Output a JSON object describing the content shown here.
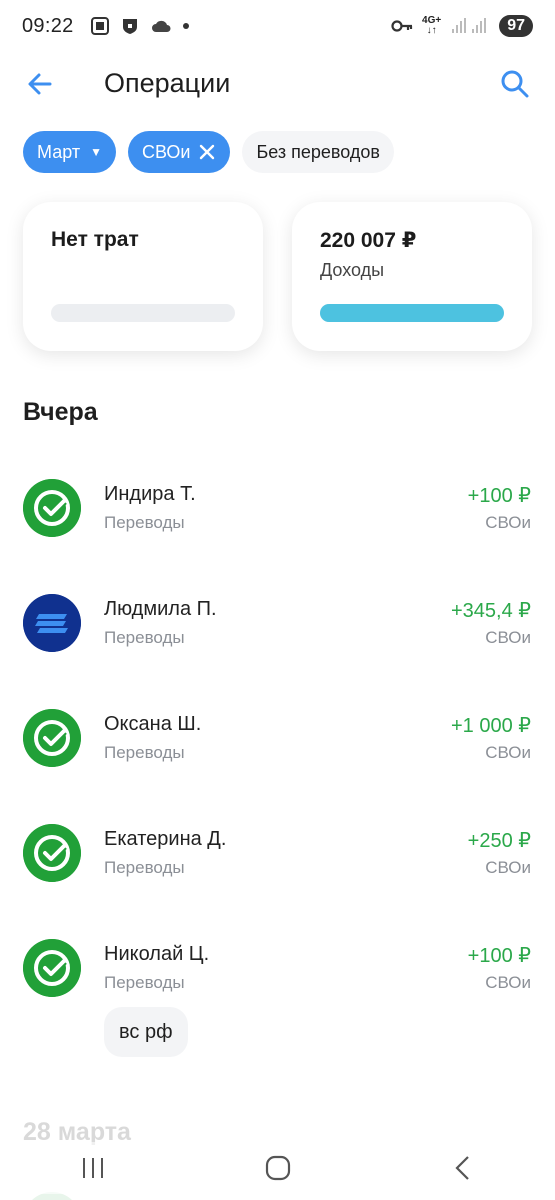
{
  "status_bar": {
    "time": "09:22",
    "network": "4G+",
    "battery": "97",
    "icons": [
      "screenshot-icon",
      "shield-icon",
      "cloud-icon",
      "dot-icon",
      "key-icon",
      "signal-icon"
    ]
  },
  "header": {
    "title": "Операции",
    "back_icon": "arrow-left-icon",
    "search_icon": "search-icon"
  },
  "filters": {
    "month": "Март",
    "account": "СВОи",
    "no_transfers": "Без переводов"
  },
  "summary": {
    "expenses": {
      "title": "Нет трат",
      "fill": 0
    },
    "income": {
      "amount": "220 007 ₽",
      "label": "Доходы",
      "fill": 1.0,
      "color": "#4dc2e0"
    }
  },
  "sections": {
    "yesterday": "Вчера",
    "next": "28 марта"
  },
  "transactions": [
    {
      "name": "Индира Т.",
      "category": "Переводы",
      "amount": "+100 ₽",
      "source": "СВОи",
      "icon": "sber-check-icon"
    },
    {
      "name": "Людмила П.",
      "category": "Переводы",
      "amount": "+345,4 ₽",
      "source": "СВОи",
      "icon": "bank-logo-icon"
    },
    {
      "name": "Оксана Ш.",
      "category": "Переводы",
      "amount": "+1 000 ₽",
      "source": "СВОи",
      "icon": "sber-check-icon"
    },
    {
      "name": "Екатерина Д.",
      "category": "Переводы",
      "amount": "+250 ₽",
      "source": "СВОи",
      "icon": "sber-check-icon"
    },
    {
      "name": "Николай Ц.",
      "category": "Переводы",
      "amount": "+100 ₽",
      "source": "СВОи",
      "icon": "sber-check-icon",
      "comment": "вс рф"
    }
  ],
  "colors": {
    "accent": "#3d8ff0",
    "income": "#2ba84a",
    "sber": "#21a038"
  }
}
